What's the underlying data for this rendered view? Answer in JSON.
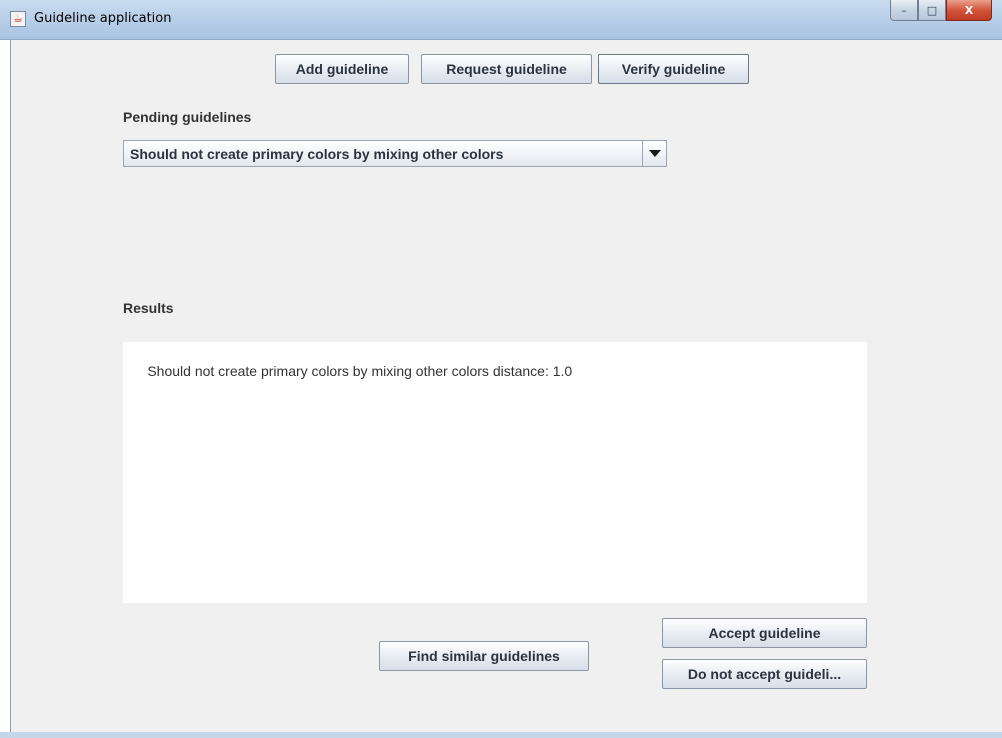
{
  "window": {
    "title": "Guideline application",
    "controls": {
      "minimize": "–",
      "maximize": "□",
      "close": "X"
    }
  },
  "toolbar": {
    "add_label": "Add guideline",
    "request_label": "Request guideline",
    "verify_label": "Verify guideline"
  },
  "pending": {
    "label": "Pending guidelines",
    "selected": "Should not create primary colors by mixing other colors"
  },
  "results": {
    "label": "Results",
    "text": "Should not create primary colors by mixing other colors distance: 1.0"
  },
  "actions": {
    "find_similar_label": "Find similar guidelines",
    "accept_label": "Accept guideline",
    "reject_label": "Do not accept guideli..."
  },
  "icons": {
    "app": "java-cup-icon"
  }
}
